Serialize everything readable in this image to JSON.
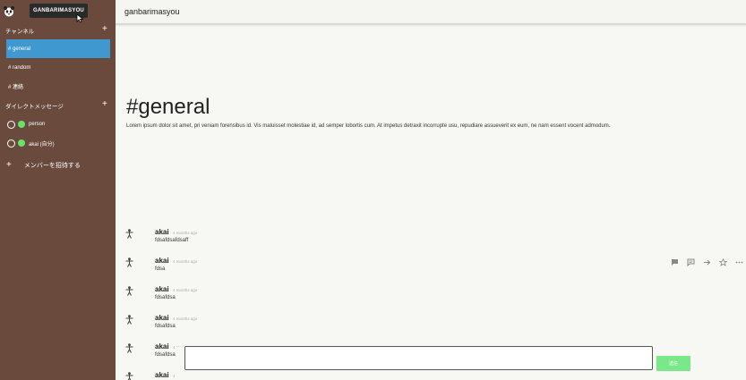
{
  "sidebar": {
    "workspace_label": "GANBARIMASYOU",
    "channels_heading": "チャンネル",
    "channels": [
      {
        "label": "# general",
        "active": true
      },
      {
        "label": "# random",
        "active": false
      },
      {
        "label": "# 連絡",
        "active": false
      }
    ],
    "dm_heading": "ダイレクトメッセージ",
    "dms": [
      {
        "label": "person"
      },
      {
        "label": "akai (自分)"
      }
    ],
    "invite_label": "メンバーを招待する",
    "add_symbol": "+"
  },
  "header": {
    "title": "ganbarimasyou"
  },
  "channel": {
    "title": "#general",
    "description": "Lorem ipsum dolor sit amet, pri veniam forensibus id. Vis maluisset molestiae id, ad semper lobortis cum. At impetus detraxit incorrupte usu, repudiare assueverit ex eum, ne nam essent vocent admodum."
  },
  "messages": [
    {
      "author": "akai",
      "time": "4 months ago",
      "text": "fdsafdsafdsaff"
    },
    {
      "author": "akai",
      "time": "4 months ago",
      "text": "fdsa"
    },
    {
      "author": "akai",
      "time": "4 months ago",
      "text": "fdsafdsa"
    },
    {
      "author": "akai",
      "time": "4 months ago",
      "text": "fdsafdsa"
    },
    {
      "author": "akai",
      "time": "4 mon",
      "text": "fdsafdsa"
    },
    {
      "author": "akai",
      "time": "4 mon",
      "text": ""
    }
  ],
  "composer": {
    "value": "",
    "send_label": "送信"
  },
  "colors": {
    "sidebar": "#6b4a3e",
    "active": "#3f98d0",
    "online": "#67e36b",
    "send": "#79e888"
  }
}
